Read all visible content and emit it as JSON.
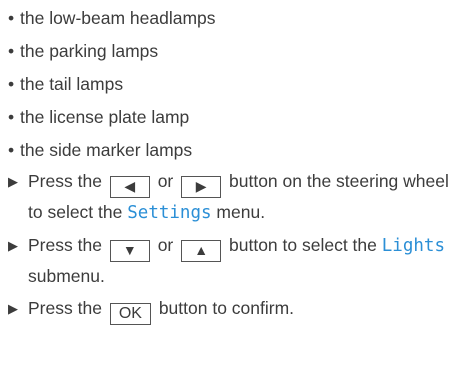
{
  "bullets": [
    "the low-beam headlamps",
    "the parking lamps",
    "the tail lamps",
    "the license plate lamp",
    "the side marker lamps"
  ],
  "bullet_symbol": "•",
  "step_symbol": "▶",
  "steps": {
    "s1": {
      "pre": "Press the",
      "key_left": "◀",
      "or": "or",
      "key_right": "▶",
      "mid": "button on the steering wheel to select the",
      "menu": "Settings",
      "post": "menu."
    },
    "s2": {
      "pre": "Press the",
      "key_down": "▼",
      "or": "or",
      "key_up": "▲",
      "mid": "button to select the",
      "menu": "Lights",
      "post": "submenu."
    },
    "s3": {
      "pre": "Press the",
      "key_ok": "OK",
      "post": "button to confirm."
    }
  },
  "colors": {
    "text": "#3c3c3c",
    "menu_term": "#2b8fd6"
  }
}
